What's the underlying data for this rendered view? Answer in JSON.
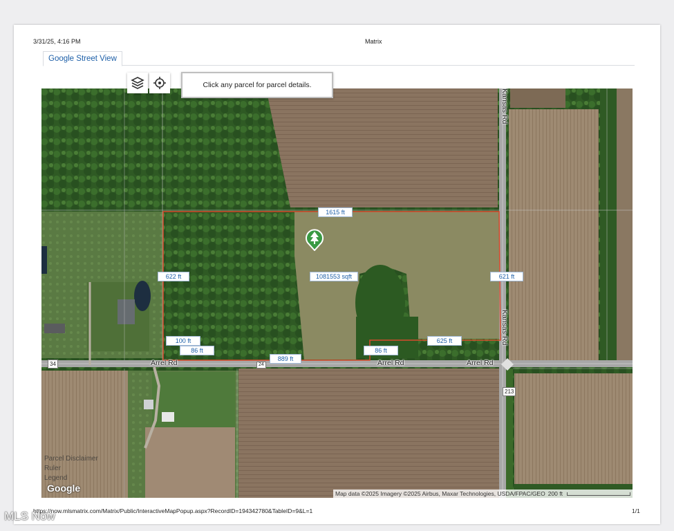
{
  "header": {
    "datetime": "3/31/25, 4:16 PM",
    "title": "Matrix"
  },
  "tab": {
    "label": "Google Street View"
  },
  "map_toolbar": {
    "layers_icon": "layers-icon",
    "locate_icon": "crosshair-icon",
    "info_text": "Click any parcel for parcel details."
  },
  "parcel": {
    "area": "1081553 sqft",
    "marker_icon": "tree-pin-icon",
    "measurements": {
      "top": "1615 ft",
      "left": "622 ft",
      "right": "621 ft",
      "bottom_left_a": "100 ft",
      "bottom_left_b": "86 ft",
      "bottom_center": "889 ft",
      "bottom_right_a": "86 ft",
      "bottom_right_b": "625 ft"
    },
    "outline_color": "#d94a2c"
  },
  "roads": {
    "arrel_1": "Arrel Rd",
    "arrel_2": "Arrel Rd",
    "arrel_3": "Arrel Rd",
    "kansas_top": "Kansas Rd",
    "kansas_mid": "Kansas Rd",
    "route_34": "34",
    "route_24": "24",
    "route_213": "213"
  },
  "legend": {
    "disclaimer": "Parcel Disclaimer",
    "ruler": "Ruler",
    "legend": "Legend"
  },
  "google_logo": "Google",
  "attribution": {
    "text": "Map data ©2025 Imagery ©2025 Airbus, Maxar Technologies, USDA/FPAC/GEO",
    "scale": "200 ft"
  },
  "footer": {
    "url": "https://now.mlsmatrix.com/Matrix/Public/InteractiveMapPopup.aspx?RecordID=194342780&TableID=9&L=1",
    "page": "1/1"
  },
  "watermark": "MLS Now"
}
